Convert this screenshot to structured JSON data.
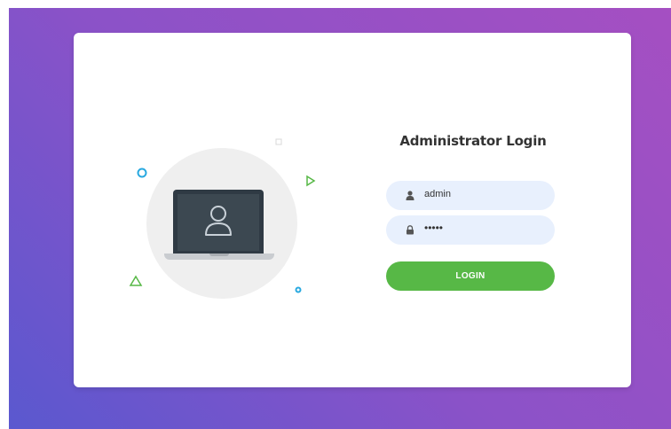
{
  "login": {
    "title": "Administrator Login",
    "username_value": "admin",
    "password_value": "•••••",
    "submit_label": "LOGIN"
  },
  "icons": {
    "username_field": "user-icon",
    "password_field": "lock-icon",
    "illustration": "laptop-user-icon"
  },
  "colors": {
    "background_gradient_start": "#5a58cf",
    "background_gradient_end": "#a54fc2",
    "card": "#ffffff",
    "field_background": "#e8f0fd",
    "login_button": "#57b846",
    "title_text": "#333333"
  }
}
